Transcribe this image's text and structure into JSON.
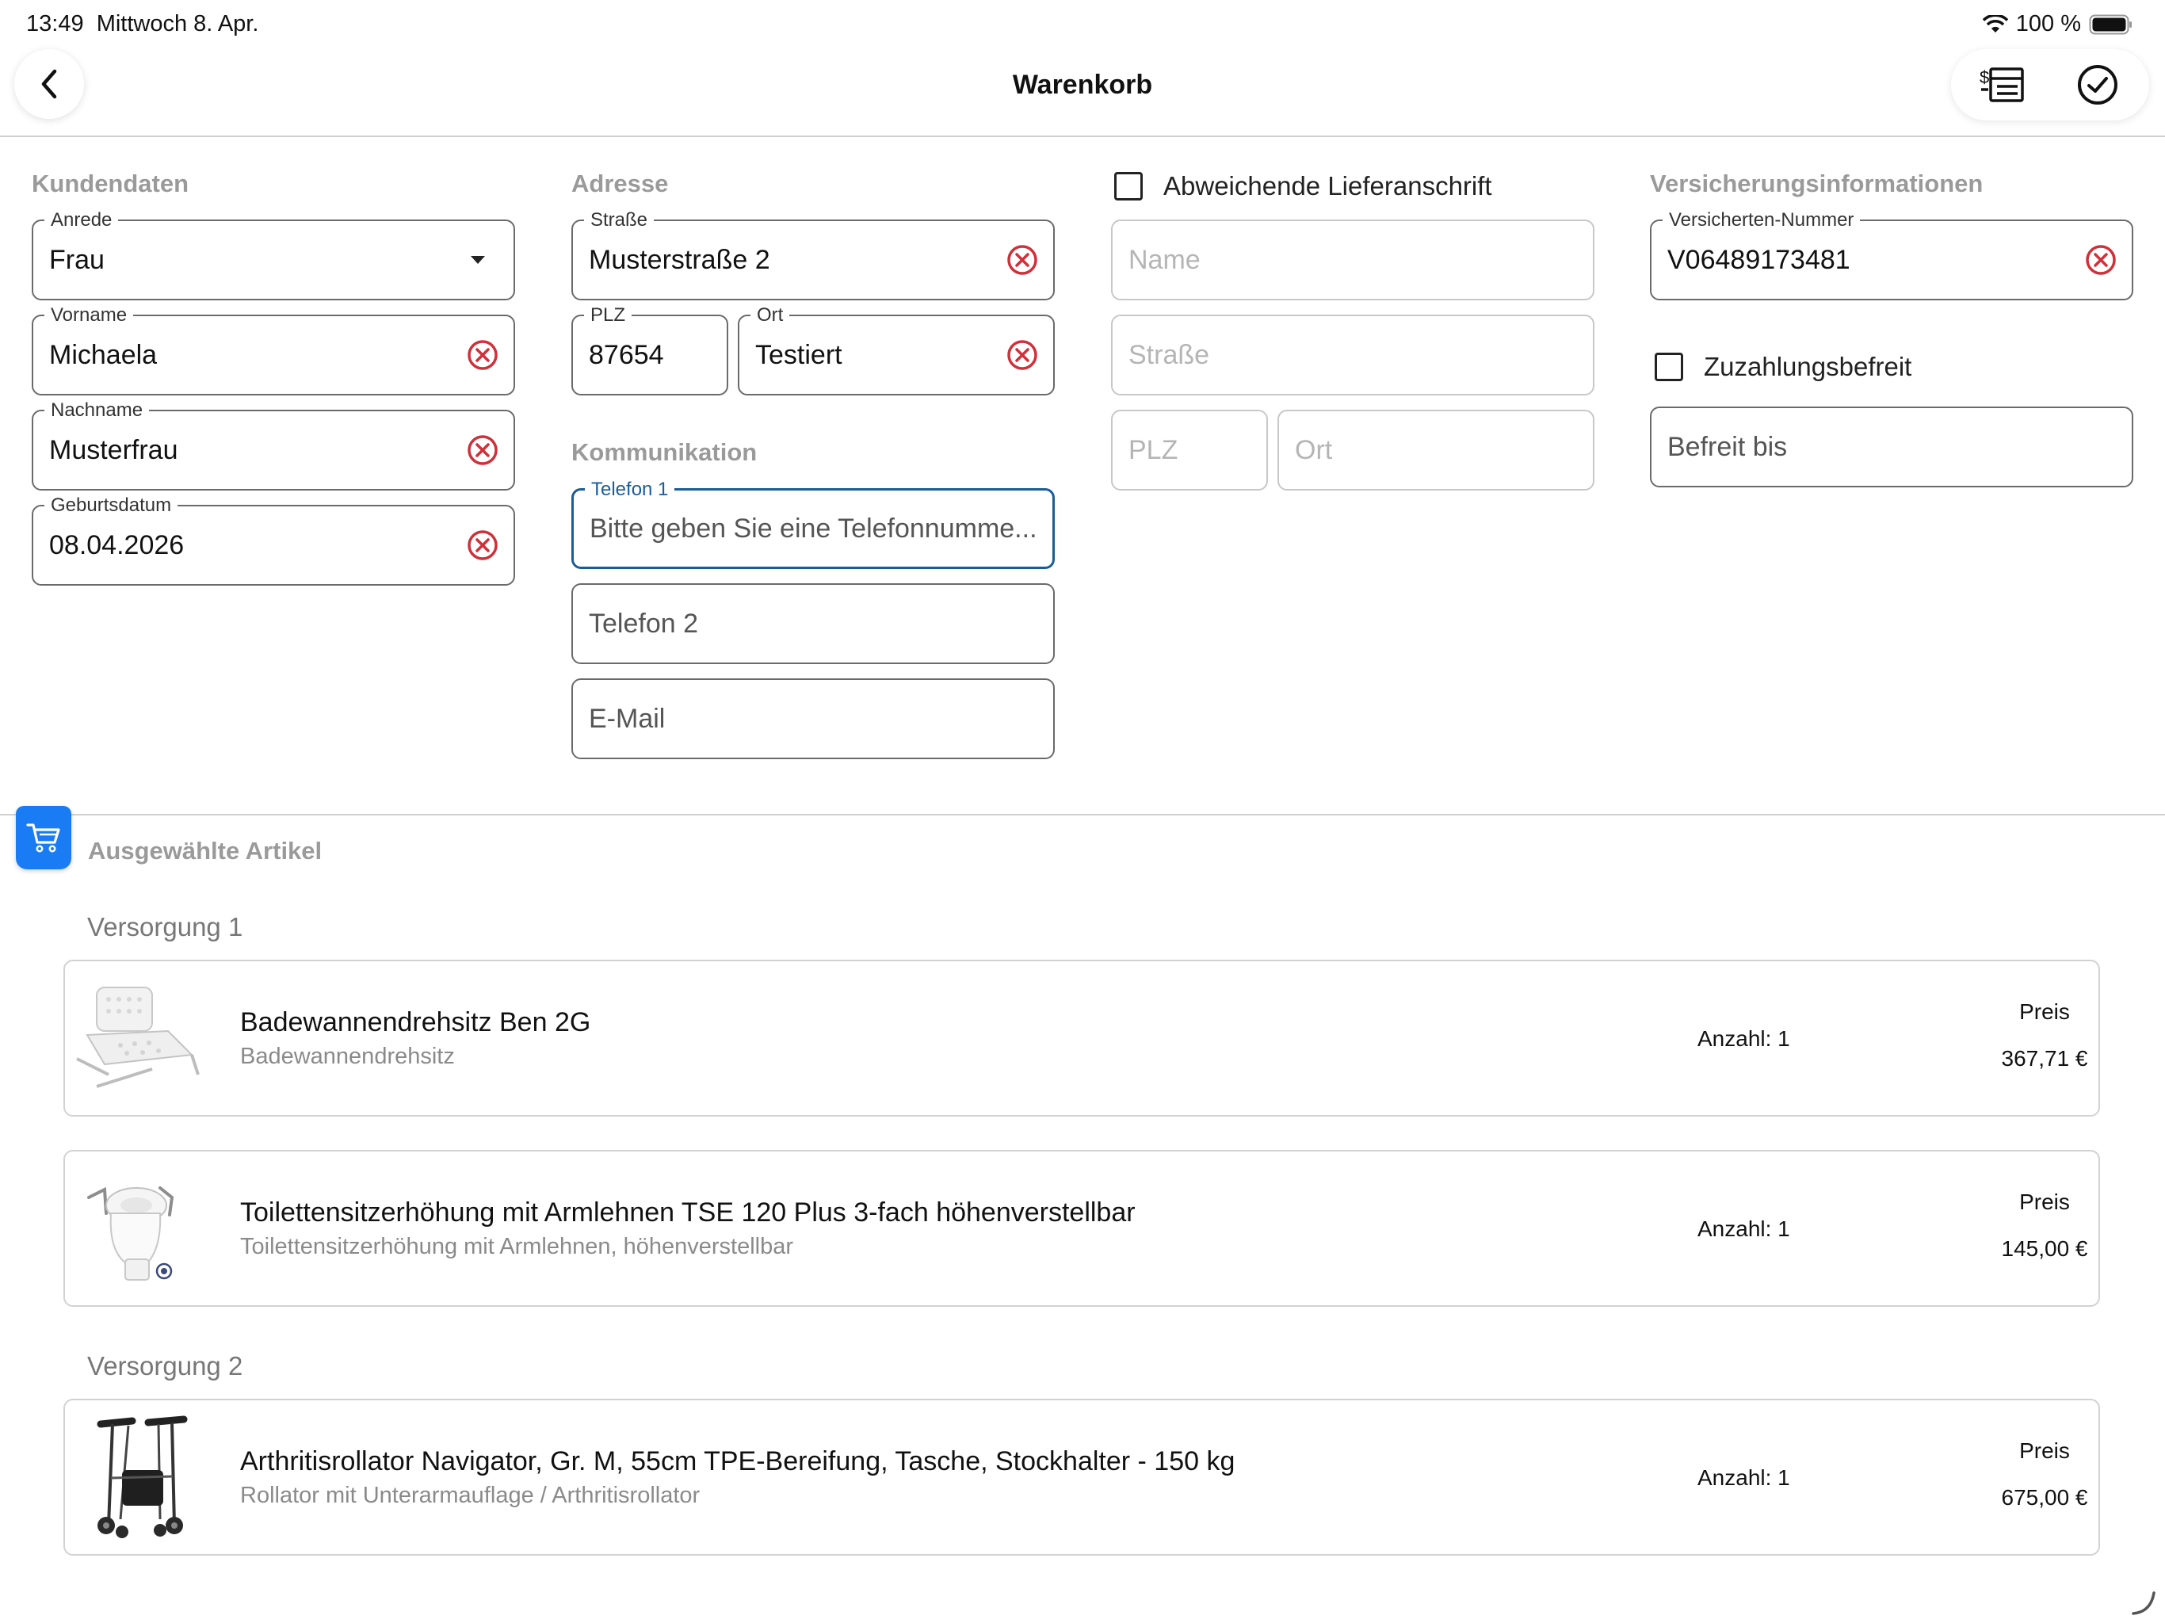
{
  "status_bar": {
    "time": "13:49",
    "date": "Mittwoch 8. Apr.",
    "battery": "100 %"
  },
  "nav": {
    "title": "Warenkorb"
  },
  "kundendaten": {
    "heading": "Kundendaten",
    "anrede": {
      "label": "Anrede",
      "value": "Frau"
    },
    "vorname": {
      "label": "Vorname",
      "value": "Michaela"
    },
    "nachname": {
      "label": "Nachname",
      "value": "Musterfrau"
    },
    "geburtsdatum": {
      "label": "Geburtsdatum",
      "value": "08.04.2026"
    }
  },
  "adresse": {
    "heading": "Adresse",
    "strasse": {
      "label": "Straße",
      "value": "Musterstraße 2"
    },
    "plz": {
      "label": "PLZ",
      "value": "87654"
    },
    "ort": {
      "label": "Ort",
      "value": "Testiert"
    }
  },
  "kommunikation": {
    "heading": "Kommunikation",
    "telefon1": {
      "label": "Telefon 1",
      "placeholder": "Bitte geben Sie eine Telefonnumme..."
    },
    "telefon2": {
      "placeholder": "Telefon 2"
    },
    "email": {
      "placeholder": "E-Mail"
    }
  },
  "lieferanschrift": {
    "checkbox_label": "Abweichende Lieferanschrift",
    "checked": false,
    "name": {
      "placeholder": "Name"
    },
    "strasse": {
      "placeholder": "Straße"
    },
    "plz": {
      "placeholder": "PLZ"
    },
    "ort": {
      "placeholder": "Ort"
    }
  },
  "versicherung": {
    "heading": "Versicherungsinformationen",
    "nummer": {
      "label": "Versicherten-Nummer",
      "value": "V06489173481"
    },
    "zuzahlung": {
      "label": "Zuzahlungsbefreit",
      "checked": false
    },
    "befreit_bis": {
      "placeholder": "Befreit bis"
    }
  },
  "artikel": {
    "heading": "Ausgewählte Artikel",
    "groups": [
      {
        "label": "Versorgung 1",
        "items": [
          {
            "name": "Badewannendrehsitz Ben 2G",
            "subtitle": "Badewannendrehsitz",
            "qty": "Anzahl: 1",
            "price_label": "Preis",
            "price": "367,71 €"
          },
          {
            "name": "Toilettensitzerhöhung mit Armlehnen TSE 120 Plus 3-fach höhenverstellbar",
            "subtitle": "Toilettensitzerhöhung mit Armlehnen, höhenverstellbar",
            "qty": "Anzahl: 1",
            "price_label": "Preis",
            "price": "145,00 €"
          }
        ]
      },
      {
        "label": "Versorgung 2",
        "items": [
          {
            "name": "Arthritisrollator Navigator, Gr. M, 55cm TPE-Bereifung, Tasche, Stockhalter - 150 kg",
            "subtitle": "Rollator mit Unterarmauflage / Arthritisrollator",
            "qty": "Anzahl: 1",
            "price_label": "Preis",
            "price": "675,00 €"
          }
        ]
      }
    ]
  },
  "colors": {
    "accent": "#1a7cf5",
    "focus": "#1a5d96",
    "clear_icon": "#d0303a"
  },
  "icons": [
    "back-chevron-icon",
    "invoice-list-icon",
    "check-circle-icon",
    "clear-icon",
    "dropdown-caret-icon",
    "shopping-cart-icon",
    "wifi-icon",
    "battery-icon"
  ]
}
